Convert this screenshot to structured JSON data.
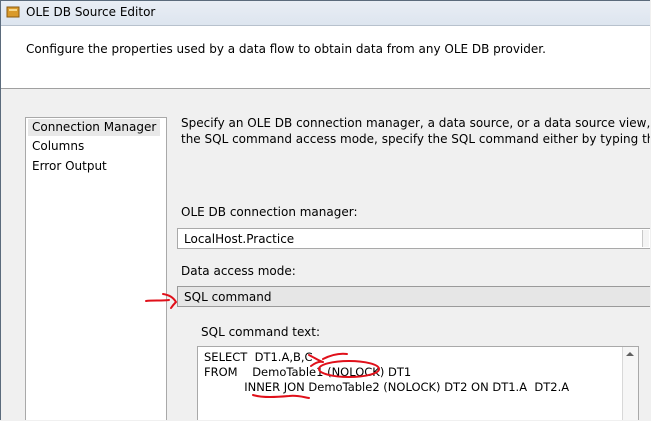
{
  "window": {
    "title": "OLE DB Source Editor",
    "header_text": "Configure the properties used by a data flow to obtain data from any OLE DB provider."
  },
  "nav": {
    "items": [
      {
        "label": "Connection Manager",
        "selected": true
      },
      {
        "label": "Columns",
        "selected": false
      },
      {
        "label": "Error Output",
        "selected": false
      }
    ]
  },
  "main": {
    "description_line1": "Specify an OLE DB connection manager, a data source, or a data source view, and select th",
    "description_line2": "the SQL command access mode, specify the SQL command either by typing the query or",
    "connection_manager_label": "OLE DB connection manager:",
    "connection_manager_value": "LocalHost.Practice",
    "access_mode_label": "Data access mode:",
    "access_mode_value": "SQL command",
    "sql_text_label": "SQL command text:",
    "sql_lines": [
      "SELECT  DT1.A,B,C",
      "FROM    DemoTable1 (NOLOCK) DT1",
      "           INNER JON DemoTable2 (NOLOCK) DT2 ON DT1.A  DT2.A"
    ]
  },
  "colors": {
    "annotation": "#e0101a",
    "title_icon": "#d99a2b"
  },
  "icons": {
    "title": "ole-db-source-icon",
    "dropdown": "chevron-down-icon"
  }
}
